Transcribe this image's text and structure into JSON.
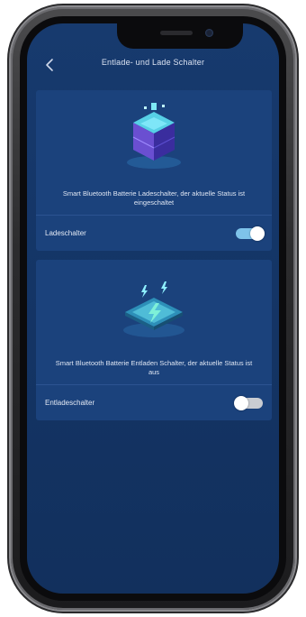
{
  "nav": {
    "back_icon": "chevron-left-icon",
    "title": "Entlade- und Lade Schalter"
  },
  "charge_card": {
    "illustration_icon": "battery-cube-icon",
    "description": "Smart Bluetooth Batterie Ladeschalter, der aktuelle Status ist eingeschaltet",
    "switch_label": "Ladeschalter",
    "switch_on": true
  },
  "discharge_card": {
    "illustration_icon": "lightning-tile-icon",
    "description": "Smart Bluetooth Batterie Entladen Schalter, der aktuelle Status ist aus",
    "switch_label": "Entladeschalter",
    "switch_on": false
  },
  "colors": {
    "background": "#143566",
    "card": "#1b427c",
    "toggle_on": "#7ec3ea",
    "toggle_off": "#c9ccd2"
  }
}
